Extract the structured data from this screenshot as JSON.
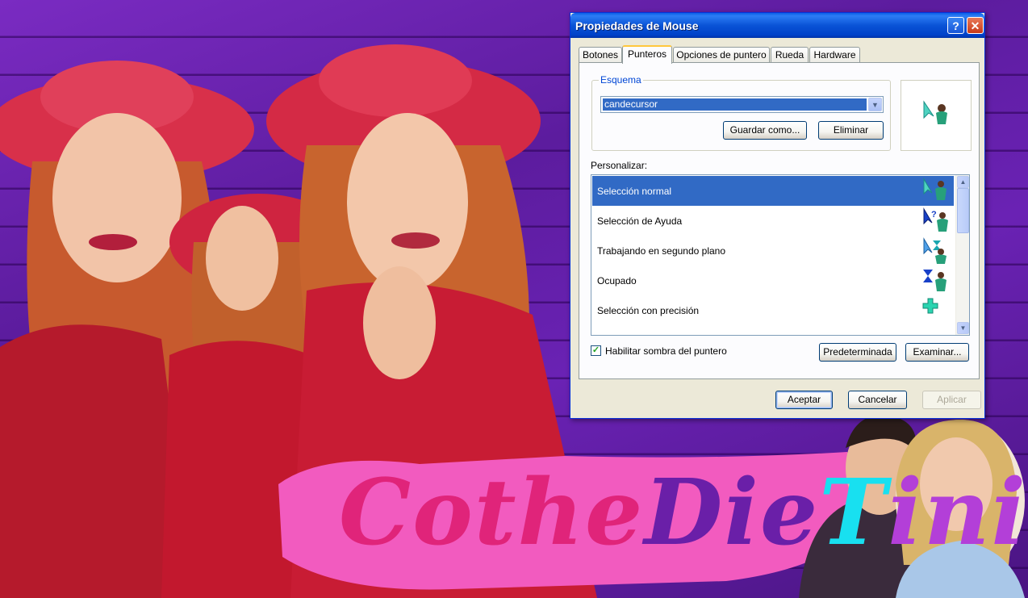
{
  "dialog": {
    "title": "Propiedades de Mouse",
    "help_icon": "question-icon",
    "close_icon": "close-icon",
    "tabs": [
      {
        "label": "Botones"
      },
      {
        "label": "Punteros",
        "active": true
      },
      {
        "label": "Opciones de puntero"
      },
      {
        "label": "Rueda"
      },
      {
        "label": "Hardware"
      }
    ],
    "scheme": {
      "group_label": "Esquema",
      "selected_value": "candecursor",
      "save_as_label": "Guardar como...",
      "delete_label": "Eliminar"
    },
    "customize_label": "Personalizar:",
    "cursor_list": [
      {
        "label": "Selección normal",
        "selected": true
      },
      {
        "label": "Selección de Ayuda"
      },
      {
        "label": "Trabajando en segundo plano"
      },
      {
        "label": "Ocupado"
      },
      {
        "label": "Selección con precisión"
      }
    ],
    "shadow_checkbox": {
      "label": "Habilitar sombra del puntero",
      "checked": true
    },
    "default_label": "Predeterminada",
    "browse_label": "Examinar...",
    "ok_label": "Aceptar",
    "cancel_label": "Cancelar",
    "apply_label": "Aplicar"
  },
  "banner": {
    "text_part1": "Cothe",
    "text_part2": "Die",
    "text_part3": "T",
    "text_part4": "ini"
  },
  "colors": {
    "background": "#6a22b4",
    "xp_blue": "#0a53d6",
    "selection": "#316ac5",
    "banner_pink": "#e0247a",
    "banner_purple": "#6a1fa8",
    "banner_cyan": "#18e0f0"
  }
}
